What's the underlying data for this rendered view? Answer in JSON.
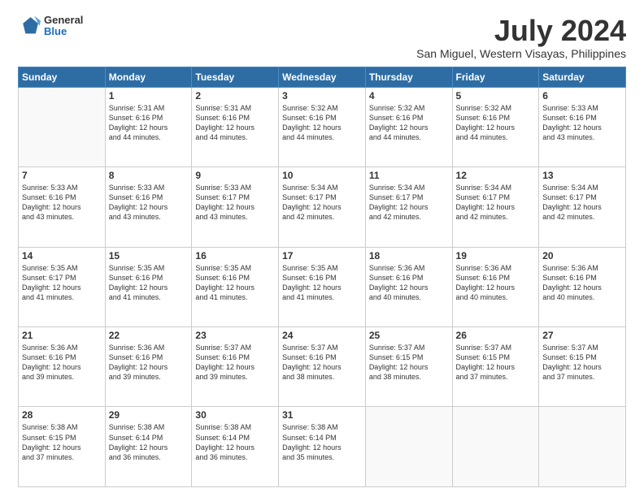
{
  "header": {
    "logo": {
      "line1": "General",
      "line2": "Blue"
    },
    "title": "July 2024",
    "subtitle": "San Miguel, Western Visayas, Philippines"
  },
  "days_of_week": [
    "Sunday",
    "Monday",
    "Tuesday",
    "Wednesday",
    "Thursday",
    "Friday",
    "Saturday"
  ],
  "weeks": [
    [
      {
        "day": "",
        "info": ""
      },
      {
        "day": "1",
        "info": "Sunrise: 5:31 AM\nSunset: 6:16 PM\nDaylight: 12 hours\nand 44 minutes."
      },
      {
        "day": "2",
        "info": "Sunrise: 5:31 AM\nSunset: 6:16 PM\nDaylight: 12 hours\nand 44 minutes."
      },
      {
        "day": "3",
        "info": "Sunrise: 5:32 AM\nSunset: 6:16 PM\nDaylight: 12 hours\nand 44 minutes."
      },
      {
        "day": "4",
        "info": "Sunrise: 5:32 AM\nSunset: 6:16 PM\nDaylight: 12 hours\nand 44 minutes."
      },
      {
        "day": "5",
        "info": "Sunrise: 5:32 AM\nSunset: 6:16 PM\nDaylight: 12 hours\nand 44 minutes."
      },
      {
        "day": "6",
        "info": "Sunrise: 5:33 AM\nSunset: 6:16 PM\nDaylight: 12 hours\nand 43 minutes."
      }
    ],
    [
      {
        "day": "7",
        "info": "Sunrise: 5:33 AM\nSunset: 6:16 PM\nDaylight: 12 hours\nand 43 minutes."
      },
      {
        "day": "8",
        "info": "Sunrise: 5:33 AM\nSunset: 6:16 PM\nDaylight: 12 hours\nand 43 minutes."
      },
      {
        "day": "9",
        "info": "Sunrise: 5:33 AM\nSunset: 6:17 PM\nDaylight: 12 hours\nand 43 minutes."
      },
      {
        "day": "10",
        "info": "Sunrise: 5:34 AM\nSunset: 6:17 PM\nDaylight: 12 hours\nand 42 minutes."
      },
      {
        "day": "11",
        "info": "Sunrise: 5:34 AM\nSunset: 6:17 PM\nDaylight: 12 hours\nand 42 minutes."
      },
      {
        "day": "12",
        "info": "Sunrise: 5:34 AM\nSunset: 6:17 PM\nDaylight: 12 hours\nand 42 minutes."
      },
      {
        "day": "13",
        "info": "Sunrise: 5:34 AM\nSunset: 6:17 PM\nDaylight: 12 hours\nand 42 minutes."
      }
    ],
    [
      {
        "day": "14",
        "info": "Sunrise: 5:35 AM\nSunset: 6:17 PM\nDaylight: 12 hours\nand 41 minutes."
      },
      {
        "day": "15",
        "info": "Sunrise: 5:35 AM\nSunset: 6:16 PM\nDaylight: 12 hours\nand 41 minutes."
      },
      {
        "day": "16",
        "info": "Sunrise: 5:35 AM\nSunset: 6:16 PM\nDaylight: 12 hours\nand 41 minutes."
      },
      {
        "day": "17",
        "info": "Sunrise: 5:35 AM\nSunset: 6:16 PM\nDaylight: 12 hours\nand 41 minutes."
      },
      {
        "day": "18",
        "info": "Sunrise: 5:36 AM\nSunset: 6:16 PM\nDaylight: 12 hours\nand 40 minutes."
      },
      {
        "day": "19",
        "info": "Sunrise: 5:36 AM\nSunset: 6:16 PM\nDaylight: 12 hours\nand 40 minutes."
      },
      {
        "day": "20",
        "info": "Sunrise: 5:36 AM\nSunset: 6:16 PM\nDaylight: 12 hours\nand 40 minutes."
      }
    ],
    [
      {
        "day": "21",
        "info": "Sunrise: 5:36 AM\nSunset: 6:16 PM\nDaylight: 12 hours\nand 39 minutes."
      },
      {
        "day": "22",
        "info": "Sunrise: 5:36 AM\nSunset: 6:16 PM\nDaylight: 12 hours\nand 39 minutes."
      },
      {
        "day": "23",
        "info": "Sunrise: 5:37 AM\nSunset: 6:16 PM\nDaylight: 12 hours\nand 39 minutes."
      },
      {
        "day": "24",
        "info": "Sunrise: 5:37 AM\nSunset: 6:16 PM\nDaylight: 12 hours\nand 38 minutes."
      },
      {
        "day": "25",
        "info": "Sunrise: 5:37 AM\nSunset: 6:15 PM\nDaylight: 12 hours\nand 38 minutes."
      },
      {
        "day": "26",
        "info": "Sunrise: 5:37 AM\nSunset: 6:15 PM\nDaylight: 12 hours\nand 37 minutes."
      },
      {
        "day": "27",
        "info": "Sunrise: 5:37 AM\nSunset: 6:15 PM\nDaylight: 12 hours\nand 37 minutes."
      }
    ],
    [
      {
        "day": "28",
        "info": "Sunrise: 5:38 AM\nSunset: 6:15 PM\nDaylight: 12 hours\nand 37 minutes."
      },
      {
        "day": "29",
        "info": "Sunrise: 5:38 AM\nSunset: 6:14 PM\nDaylight: 12 hours\nand 36 minutes."
      },
      {
        "day": "30",
        "info": "Sunrise: 5:38 AM\nSunset: 6:14 PM\nDaylight: 12 hours\nand 36 minutes."
      },
      {
        "day": "31",
        "info": "Sunrise: 5:38 AM\nSunset: 6:14 PM\nDaylight: 12 hours\nand 35 minutes."
      },
      {
        "day": "",
        "info": ""
      },
      {
        "day": "",
        "info": ""
      },
      {
        "day": "",
        "info": ""
      }
    ]
  ]
}
